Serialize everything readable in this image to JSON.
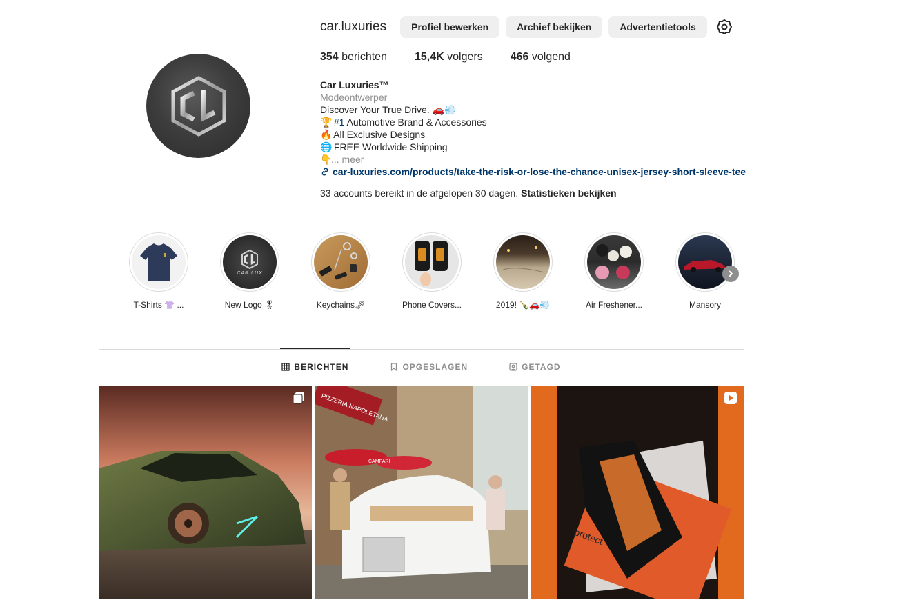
{
  "profile": {
    "username": "car.luxuries",
    "buttons": {
      "edit_profile": "Profiel bewerken",
      "view_archive": "Archief bekijken",
      "ad_tools": "Advertentietools"
    },
    "avatar_initials": "CL",
    "stats": {
      "posts_count": "354",
      "posts_label": "berichten",
      "followers_count": "15,4K",
      "followers_label": "volgers",
      "following_count": "466",
      "following_label": "volgend"
    },
    "bio": {
      "name": "Car Luxuries™",
      "category": "Modeontwerper",
      "line1": "Discover Your True Drive. 🚗💨",
      "line2_emoji": "🏆",
      "line2_hash": "#1",
      "line2_text": " Automotive Brand & Accessories",
      "line3_emoji": "🔥",
      "line3_text": "All Exclusive Designs",
      "line4_emoji": "🌐",
      "line4_text": "FREE Worldwide Shipping",
      "line5_emoji": "👇",
      "more": "... meer",
      "link": "car-luxuries.com/products/take-the-risk-or-lose-the-chance-unisex-jersey-short-sleeve-tee"
    },
    "reach_text": "33 accounts bereikt in de afgelopen 30 dagen.",
    "reach_link": "Statistieken bekijken"
  },
  "highlights": [
    {
      "label": "T-Shirts 👚 ..."
    },
    {
      "label": "New Logo 🎖",
      "logo_text": "CAR LUX"
    },
    {
      "label": "Keychains🗝"
    },
    {
      "label": "Phone Covers..."
    },
    {
      "label": "2019! 🍾🚗💨"
    },
    {
      "label": "Air Freshener..."
    },
    {
      "label": "Mansory"
    }
  ],
  "tabs": [
    {
      "label": "BERICHTEN",
      "active": true
    },
    {
      "label": "OPGESLAGEN",
      "active": false
    },
    {
      "label": "GETAGD",
      "active": false
    }
  ],
  "posts": [
    {
      "type": "carousel"
    },
    {
      "type": "image",
      "sign_text": "PIZZERIA NAPOLETANA",
      "umbrella_text": "CAMPARI"
    },
    {
      "type": "reel",
      "box_text": "protect"
    }
  ]
}
